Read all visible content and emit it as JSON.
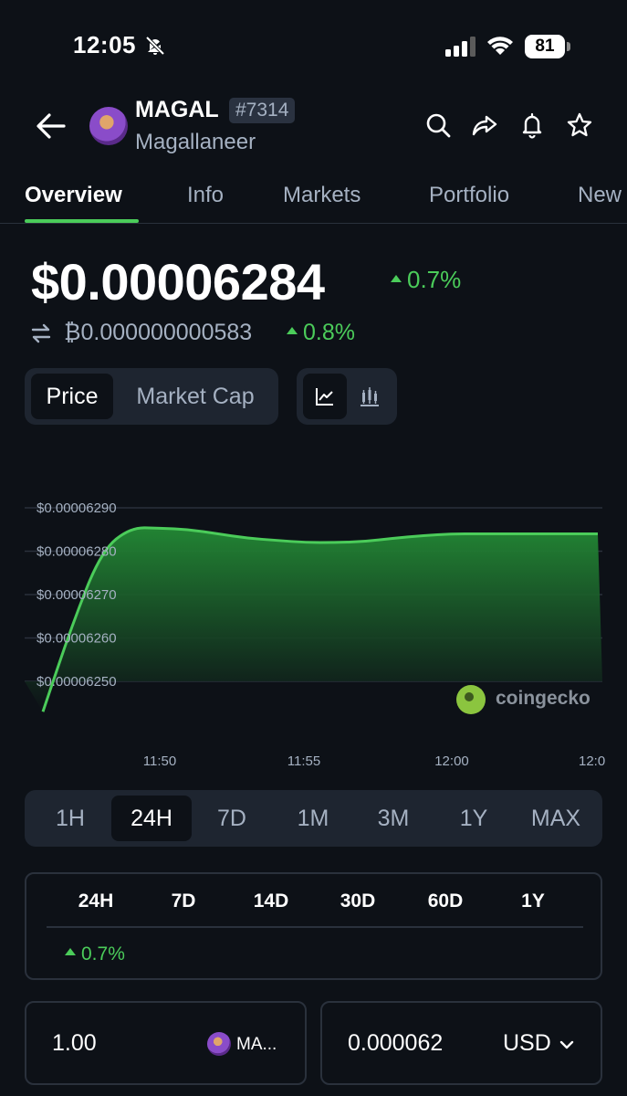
{
  "status_bar": {
    "time": "12:05",
    "battery": "81"
  },
  "header": {
    "symbol": "MAGAL",
    "rank": "#7314",
    "name": "Magallaneer",
    "icons": [
      "back-arrow-icon",
      "search-icon",
      "share-icon",
      "bell-icon",
      "star-icon"
    ]
  },
  "tabs": [
    "Overview",
    "Info",
    "Markets",
    "Portfolio",
    "New"
  ],
  "price": {
    "usd": "$0.00006284",
    "usd_change": "0.7%",
    "btc": "₿0.000000000583",
    "btc_change": "0.8%"
  },
  "chart_toggle": {
    "price": "Price",
    "market_cap": "Market Cap"
  },
  "chart_data": {
    "type": "area",
    "y_tick_labels": [
      "$0.00006290",
      "$0.00006280",
      "$0.00006270",
      "$0.00006260",
      "$0.00006250"
    ],
    "y_ticks": [
      6.29e-05,
      6.28e-05,
      6.27e-05,
      6.26e-05,
      6.25e-05
    ],
    "ylim": [
      6.25e-05,
      6.29e-05
    ],
    "x_tick_labels": [
      "11:50",
      "11:55",
      "12:00",
      "12:0"
    ],
    "series": [
      {
        "x": [
          "11:46",
          "11:47",
          "11:48",
          "11:49",
          "11:50",
          "11:51",
          "11:52",
          "11:53",
          "11:54",
          "11:55",
          "11:56",
          "11:57",
          "11:58",
          "11:59",
          "12:00",
          "12:01",
          "12:02",
          "12:03",
          "12:04",
          "12:05"
        ],
        "values": [
          6.243e-05,
          6.263e-05,
          6.28e-05,
          6.2855e-05,
          6.2853e-05,
          6.285e-05,
          6.284e-05,
          6.283e-05,
          6.2825e-05,
          6.282e-05,
          6.282e-05,
          6.2822e-05,
          6.283e-05,
          6.2836e-05,
          6.284e-05,
          6.284e-05,
          6.284e-05,
          6.284e-05,
          6.284e-05,
          6.284e-05
        ]
      }
    ],
    "watermark": "coingecko",
    "colors": {
      "line": "#4bcc5a",
      "fill_top": "#1f7a2f",
      "grid": "#2a313c"
    }
  },
  "time_ranges": [
    "1H",
    "24H",
    "7D",
    "1M",
    "3M",
    "1Y",
    "MAX"
  ],
  "active_range": "24H",
  "performance": {
    "headers": [
      "24H",
      "7D",
      "14D",
      "30D",
      "60D",
      "1Y"
    ],
    "value_24h": "0.7%"
  },
  "converter": {
    "amount": "1.00",
    "coin": "MA...",
    "usd_value": "0.000062",
    "currency": "USD"
  }
}
